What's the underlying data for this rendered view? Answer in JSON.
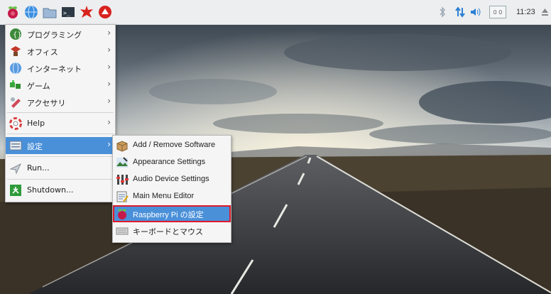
{
  "taskbar": {
    "launchers": [
      "raspberry-menu-icon",
      "web-browser-icon",
      "file-manager-icon",
      "terminal-icon",
      "mathematica-icon",
      "wolfram-icon"
    ],
    "clock": "11:23",
    "cpu_monitor": "0 0"
  },
  "main_menu": {
    "items": [
      {
        "label": "プログラミング",
        "icon": "programming-icon",
        "has_submenu": true
      },
      {
        "label": "オフィス",
        "icon": "office-icon",
        "has_submenu": true
      },
      {
        "label": "インターネット",
        "icon": "internet-globe-icon",
        "has_submenu": true
      },
      {
        "label": "ゲーム",
        "icon": "games-icon",
        "has_submenu": true
      },
      {
        "label": "アクセサリ",
        "icon": "accessories-icon",
        "has_submenu": true
      },
      {
        "label": "Help",
        "icon": "help-lifebuoy-icon",
        "has_submenu": true
      },
      {
        "label": "設定",
        "icon": "preferences-icon",
        "has_submenu": true,
        "selected": true
      },
      {
        "label": "Run...",
        "icon": "run-icon",
        "has_submenu": false
      },
      {
        "label": "Shutdown...",
        "icon": "shutdown-icon",
        "has_submenu": false
      }
    ]
  },
  "sub_menu": {
    "items": [
      {
        "label": "Add / Remove Software",
        "icon": "package-box-icon"
      },
      {
        "label": "Appearance Settings",
        "icon": "appearance-icon"
      },
      {
        "label": "Audio Device Settings",
        "icon": "audio-mixer-icon"
      },
      {
        "label": "Main Menu Editor",
        "icon": "menu-editor-icon"
      },
      {
        "label": "Raspberry Pi の設定",
        "icon": "raspberry-config-icon",
        "highlighted": true
      },
      {
        "label": "キーボードとマウス",
        "icon": "keyboard-mouse-icon"
      }
    ]
  },
  "colors": {
    "selection": "#4a90d9",
    "highlight_outline": "#e0192b",
    "menu_bg": "#f5f5f5",
    "tray_accent": "#2a7fd4"
  }
}
